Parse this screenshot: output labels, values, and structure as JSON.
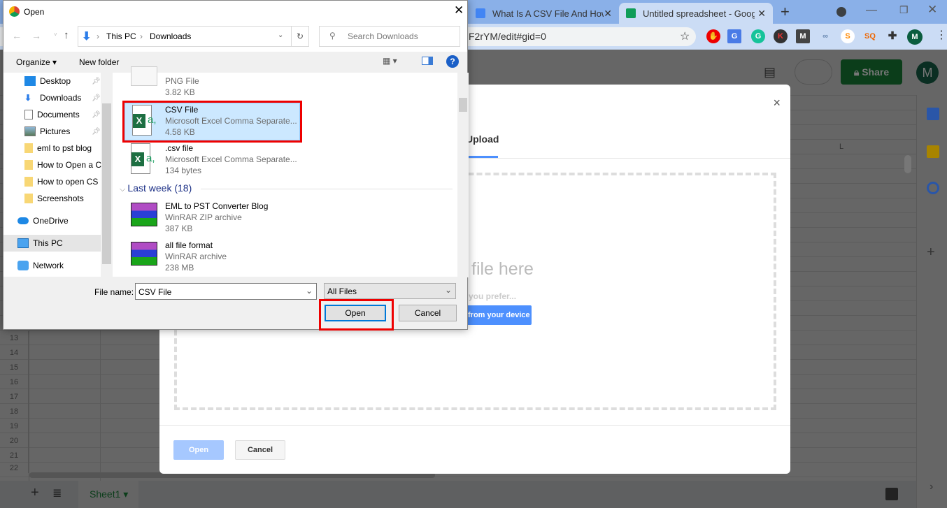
{
  "browser": {
    "tabs": [
      {
        "title": "What Is A CSV File And How I",
        "icon": "google-docs-icon"
      },
      {
        "title": "Untitled spreadsheet - Googl",
        "icon": "google-sheets-icon"
      }
    ],
    "url_fragment": "F2rYM/edit#gid=0",
    "profile_initial": "M"
  },
  "sheets": {
    "share_label": "Share",
    "avatar": "M",
    "column_label": "L",
    "rows": [
      "13",
      "14",
      "15",
      "16",
      "17",
      "18",
      "19",
      "20",
      "21",
      "22"
    ],
    "sheet_tab": "Sheet1"
  },
  "upload_dialog": {
    "tab": "Upload",
    "drop_text": "file here",
    "prefer_text": "you prefer...",
    "device_button": "from your device",
    "open": "Open",
    "cancel": "Cancel",
    "close": "×"
  },
  "file_dialog": {
    "title": "Open",
    "breadcrumb": [
      "This PC",
      "Downloads"
    ],
    "search_placeholder": "Search Downloads",
    "organize": "Organize",
    "new_folder": "New folder",
    "nav": [
      {
        "label": "Desktop",
        "pinned": true
      },
      {
        "label": "Downloads",
        "pinned": true
      },
      {
        "label": "Documents",
        "pinned": true
      },
      {
        "label": "Pictures",
        "pinned": true
      },
      {
        "label": "eml to pst blog"
      },
      {
        "label": "How to Open a C"
      },
      {
        "label": "How to open CS"
      },
      {
        "label": "Screenshots"
      },
      {
        "label": "OneDrive"
      },
      {
        "label": "This PC"
      },
      {
        "label": "Network"
      }
    ],
    "files": [
      {
        "name": "",
        "type": "PNG File",
        "size": "3.82 KB"
      },
      {
        "name": "CSV File",
        "type": "Microsoft Excel Comma Separate...",
        "size": "4.58 KB"
      },
      {
        "name": ".csv file",
        "type": "Microsoft Excel Comma Separate...",
        "size": "134 bytes"
      }
    ],
    "group": "Last week (18)",
    "files2": [
      {
        "name": "EML to PST Converter Blog",
        "type": "WinRAR ZIP archive",
        "size": "387 KB"
      },
      {
        "name": "all file format",
        "type": "WinRAR archive",
        "size": "238 MB"
      }
    ],
    "file_name_label": "File name:",
    "file_name_value": "CSV File",
    "filter": "All Files",
    "open": "Open",
    "cancel": "Cancel"
  },
  "colors": {
    "highlight": "#ff0000",
    "selection": "#cce8ff",
    "share": "#0b3d1a"
  }
}
